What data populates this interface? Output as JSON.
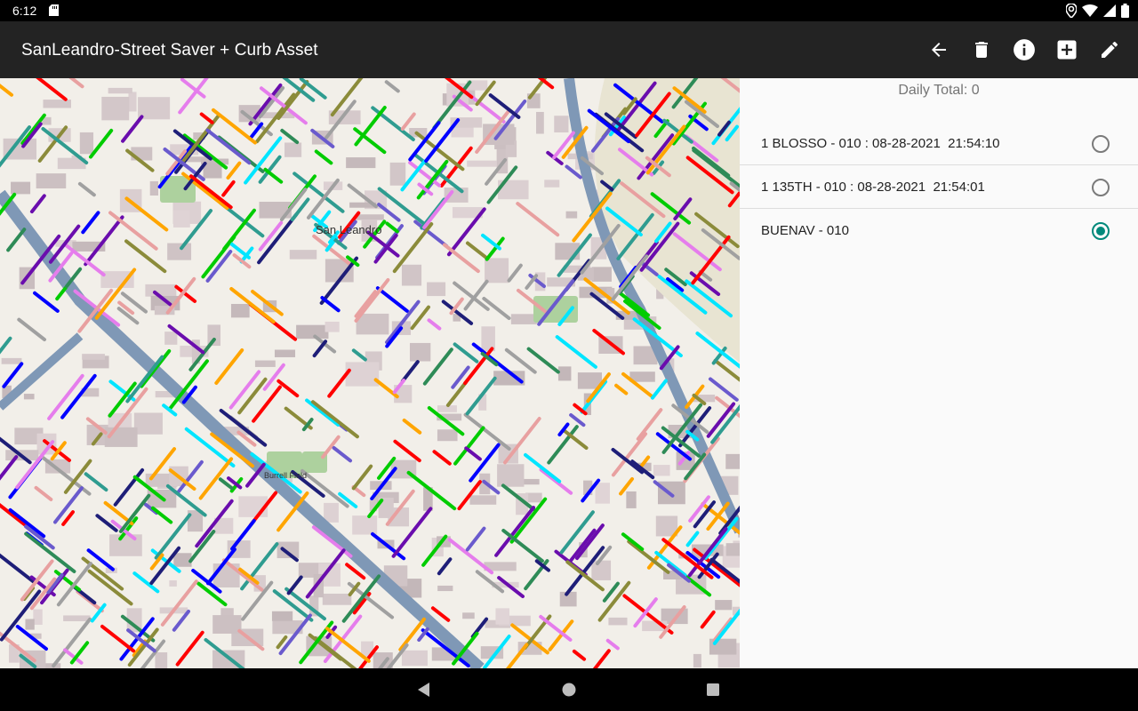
{
  "status_bar": {
    "time": "6:12",
    "icons": [
      "sd-card-icon",
      "location-icon",
      "wifi-icon",
      "signal-icon",
      "battery-icon"
    ]
  },
  "app_bar": {
    "title": "SanLeandro-Street Saver + Curb Asset",
    "actions": [
      "back-arrow-icon",
      "delete-icon",
      "info-icon",
      "add-box-icon",
      "edit-pencil-icon"
    ]
  },
  "map": {
    "labels": {
      "city": "San Leandro",
      "park": "Burrell Field"
    },
    "segment_colors": [
      "#6a0dad",
      "#0000ff",
      "#00e5ff",
      "#ff0000",
      "#ffa500",
      "#8b8b3a",
      "#e57dec",
      "#2e8b57",
      "#a0a0a0",
      "#e8a0a0",
      "#1e1e78",
      "#2f9c90",
      "#6a5acd",
      "#00cc00"
    ],
    "highway_color": "#7f98b6",
    "base_color": "#f2efe9"
  },
  "panel": {
    "daily_total": "Daily Total: 0",
    "items": [
      {
        "label": "1 BLOSSO - 010 : 08-28-2021  21:54:10",
        "checked": false
      },
      {
        "label": "1 135TH - 010 : 08-28-2021  21:54:01",
        "checked": false
      },
      {
        "label": "BUENAV - 010",
        "checked": true
      }
    ]
  },
  "nav_bar": {
    "buttons": [
      "back-triangle-icon",
      "home-circle-icon",
      "recents-square-icon"
    ]
  },
  "colors": {
    "app_bar": "#232323",
    "accent": "#00897b",
    "panel_bg": "#fafafa"
  }
}
